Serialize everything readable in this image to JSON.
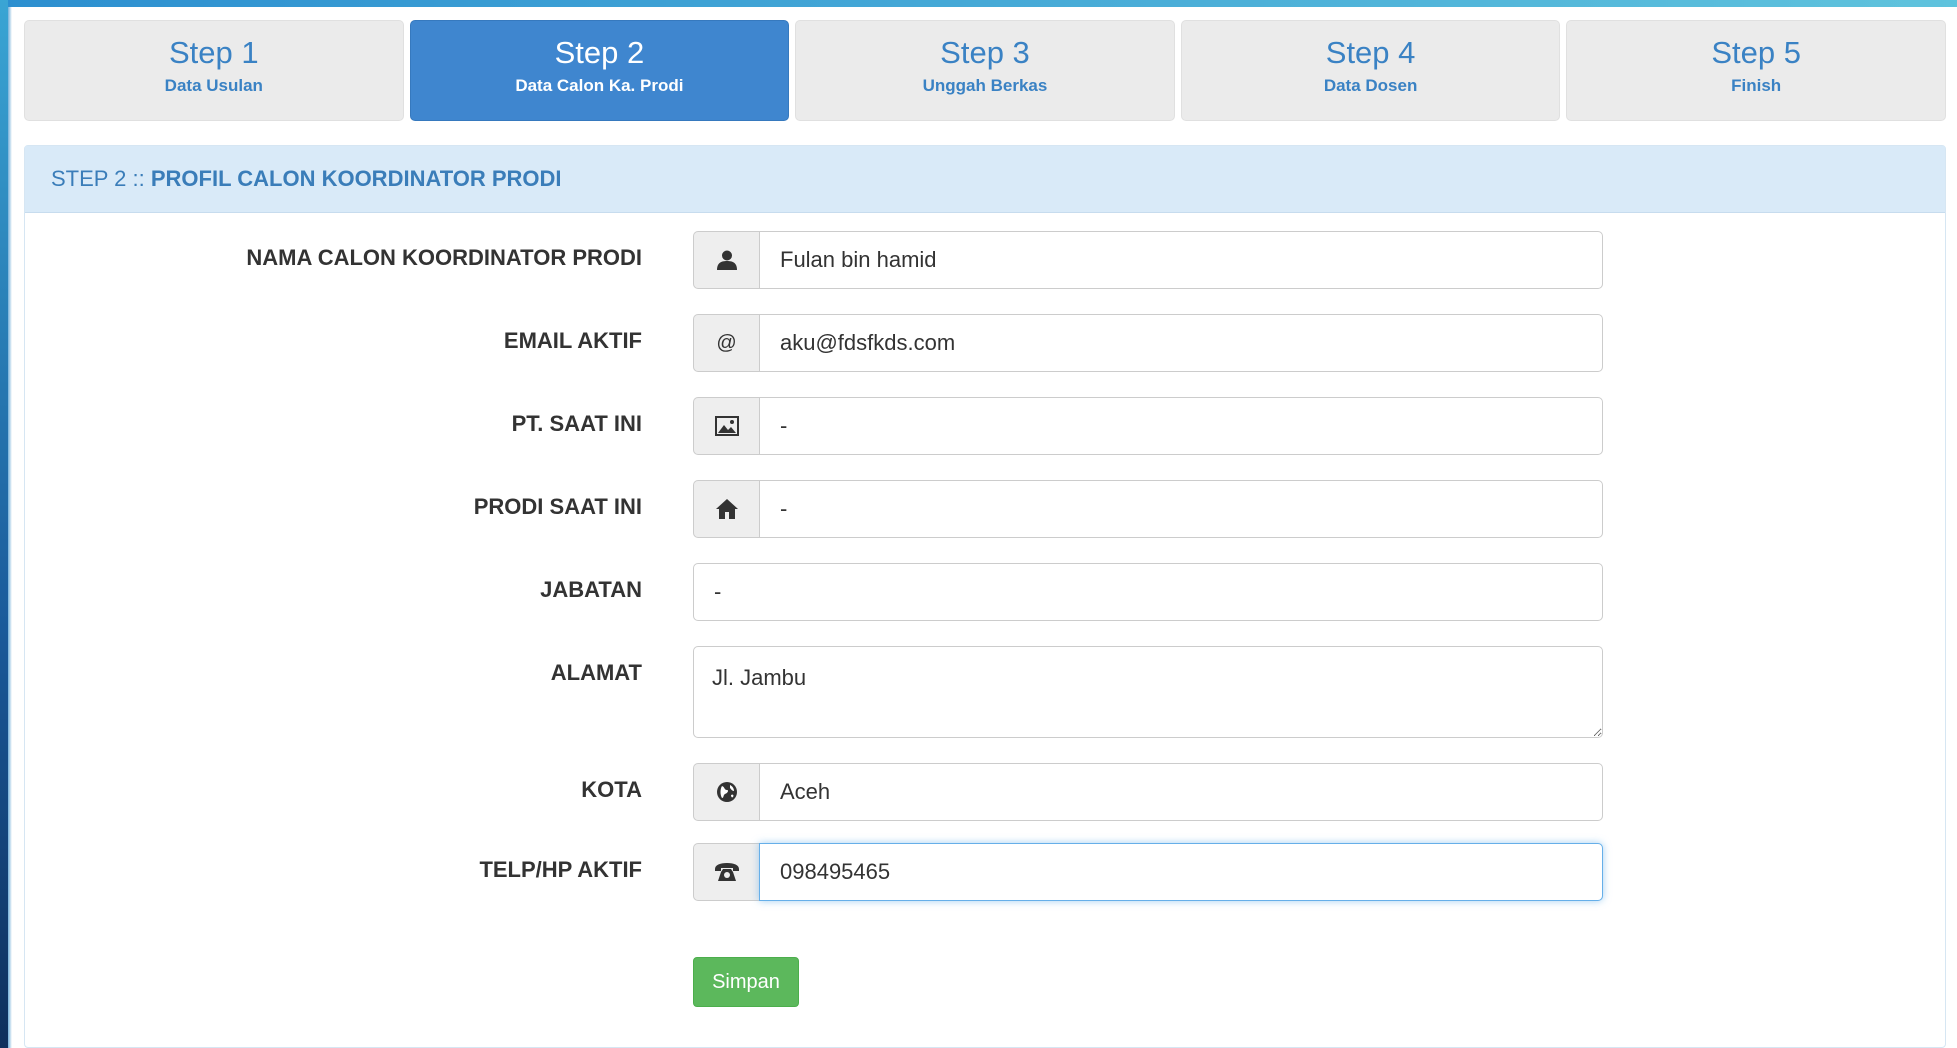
{
  "steps": [
    {
      "title": "Step 1",
      "subtitle": "Data Usulan",
      "active": false
    },
    {
      "title": "Step 2",
      "subtitle": "Data Calon Ka. Prodi",
      "active": true
    },
    {
      "title": "Step 3",
      "subtitle": "Unggah Berkas",
      "active": false
    },
    {
      "title": "Step 4",
      "subtitle": "Data Dosen",
      "active": false
    },
    {
      "title": "Step 5",
      "subtitle": "Finish",
      "active": false
    }
  ],
  "panel": {
    "heading_prefix": "STEP 2 :: ",
    "heading_title": "PROFIL CALON KOORDINATOR PRODI"
  },
  "form": {
    "nama": {
      "label": "NAMA CALON KOORDINATOR PRODI",
      "value": "Fulan bin hamid",
      "icon": "user-icon"
    },
    "email": {
      "label": "EMAIL AKTIF",
      "value": "aku@fdsfkds.com",
      "icon": "at-icon"
    },
    "pt": {
      "label": "PT. SAAT INI",
      "value": "-",
      "icon": "picture-icon"
    },
    "prodi": {
      "label": "PRODI SAAT INI",
      "value": "-",
      "icon": "home-icon"
    },
    "jabatan": {
      "label": "JABATAN",
      "value": "-"
    },
    "alamat": {
      "label": "ALAMAT",
      "value": "Jl. Jambu"
    },
    "kota": {
      "label": "KOTA",
      "value": "Aceh",
      "icon": "globe-icon"
    },
    "telp": {
      "label": "TELP/HP AKTIF",
      "value": "098495465",
      "icon": "phone-icon"
    },
    "save_label": "Simpan"
  },
  "colors": {
    "step_active": "#3f86cf",
    "step_inactive": "#ebebeb",
    "step_text": "#3a82c4",
    "panel_head_bg": "#d9eaf8",
    "save_button": "#5cb85c"
  }
}
